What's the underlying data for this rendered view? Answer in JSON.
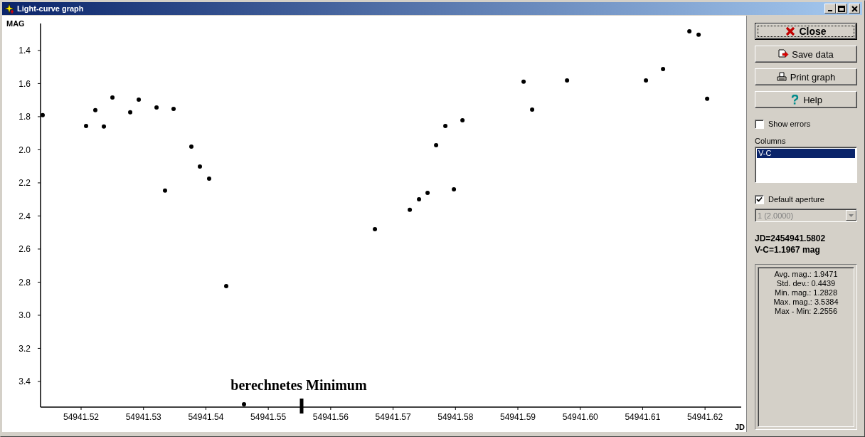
{
  "window": {
    "title": "Light-curve graph"
  },
  "chart": {
    "chart_data": {
      "type": "scatter",
      "ylabel": "MAG",
      "xlabel": "JD",
      "xlim": [
        54941.5135,
        54941.6258
      ],
      "ylim": [
        3.555,
        1.237
      ],
      "xticks": [
        {
          "value": 54941.52,
          "label": "54941.52"
        },
        {
          "value": 54941.53,
          "label": "54941.53"
        },
        {
          "value": 54941.54,
          "label": "54941.54"
        },
        {
          "value": 54941.55,
          "label": "54941.55"
        },
        {
          "value": 54941.56,
          "label": "54941.56"
        },
        {
          "value": 54941.57,
          "label": "54941.57"
        },
        {
          "value": 54941.58,
          "label": "54941.58"
        },
        {
          "value": 54941.59,
          "label": "54941.59"
        },
        {
          "value": 54941.6,
          "label": "54941.60"
        },
        {
          "value": 54941.61,
          "label": "54941.61"
        },
        {
          "value": 54941.62,
          "label": "54941.62"
        }
      ],
      "yticks": [
        {
          "value": 1.4,
          "label": "1.4"
        },
        {
          "value": 1.6,
          "label": "1.6"
        },
        {
          "value": 1.8,
          "label": "1.8"
        },
        {
          "value": 2.0,
          "label": "2.0"
        },
        {
          "value": 2.2,
          "label": "2.2"
        },
        {
          "value": 2.4,
          "label": "2.4"
        },
        {
          "value": 2.6,
          "label": "2.6"
        },
        {
          "value": 2.8,
          "label": "2.8"
        },
        {
          "value": 3.0,
          "label": "3.0"
        },
        {
          "value": 3.2,
          "label": "3.2"
        },
        {
          "value": 3.4,
          "label": "3.4"
        }
      ],
      "x": [
        54941.51384,
        54941.5208,
        54941.52228,
        54941.52365,
        54941.52502,
        54941.52787,
        54941.52924,
        54941.53209,
        54941.53345,
        54941.53482,
        54941.53767,
        54941.53904,
        54941.54052,
        54941.54326,
        54941.54611,
        54941.56709,
        54941.57268,
        54941.57416,
        54941.57553,
        54941.5769,
        54941.57838,
        54941.57975,
        54941.58112,
        54941.59092,
        54941.59229,
        54941.59788,
        54941.61053,
        54941.61327,
        54941.61749,
        54941.61897,
        54941.62034
      ],
      "series": [
        {
          "color": "#000000",
          "values": [
            1.791,
            1.856,
            1.761,
            1.86,
            1.684,
            1.774,
            1.697,
            1.744,
            2.247,
            1.753,
            1.981,
            2.101,
            2.174,
            2.824,
            3.538,
            2.48,
            2.363,
            2.299,
            2.26,
            1.972,
            1.856,
            2.239,
            1.822,
            1.589,
            1.757,
            1.581,
            1.581,
            1.512,
            1.284,
            1.305,
            1.692
          ]
        }
      ],
      "annotations": [
        "berechnetes Minimum"
      ]
    }
  },
  "buttons": [
    {
      "label": "Close",
      "kind": "close",
      "default": true
    },
    {
      "label": "Save data",
      "kind": "save",
      "default": false
    },
    {
      "label": "Print graph",
      "kind": "print",
      "default": false
    },
    {
      "label": "Help",
      "kind": "help",
      "default": false
    }
  ],
  "show_errors": {
    "label": "Show errors",
    "checked": false
  },
  "columns": {
    "label": "Columns",
    "items": [
      {
        "label": "V-C",
        "selected": true
      }
    ]
  },
  "default_aperture": {
    "label": "Default aperture",
    "checked": true
  },
  "aperture_select": {
    "value": "1 (2.0000)",
    "disabled": true
  },
  "readout": [
    "JD=2454941.5802",
    "V-C=1.1967 mag"
  ],
  "statistics": [
    "Avg. mag.: 1.9471",
    "Std. dev.: 0.4439",
    "Min. mag.: 1.2828",
    "Max. mag.: 3.5384",
    "Max - Min: 2.2556"
  ]
}
